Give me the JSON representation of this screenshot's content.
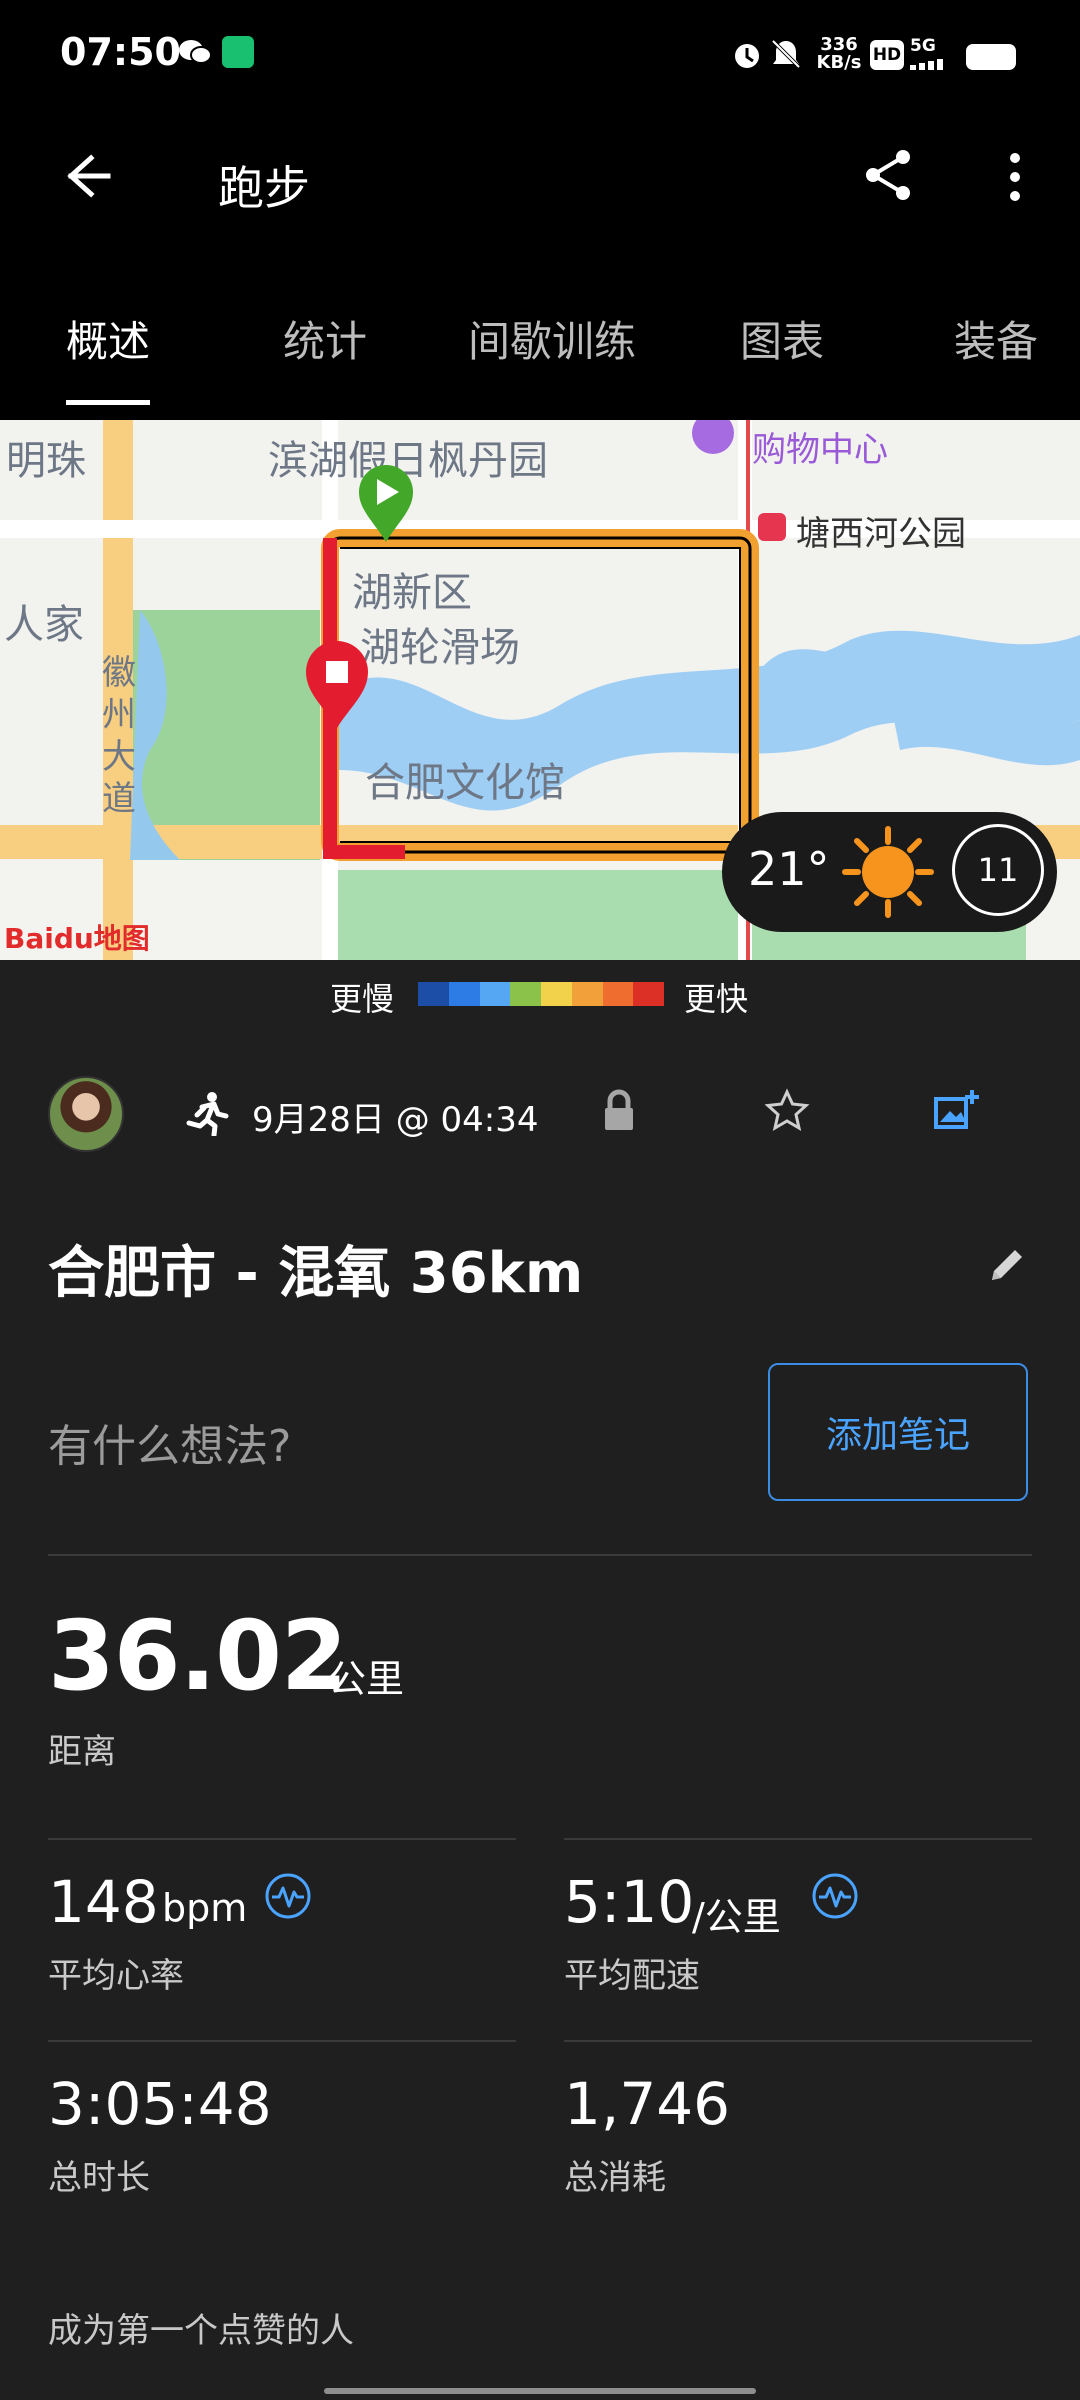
{
  "status_bar": {
    "time": "07:50",
    "network_speed_top": "336",
    "network_speed_bottom": "KB/s",
    "hd": "HD",
    "network_type": "5G"
  },
  "header": {
    "title": "跑步"
  },
  "tabs": [
    "概述",
    "统计",
    "间歇训练",
    "图表",
    "装备"
  ],
  "map": {
    "labels": {
      "mingzhu": "明珠",
      "binhu_garden": "滨湖假日枫丹园",
      "renjia": "人家",
      "binhu_xinqu": "湖新区",
      "skating": "湖轮滑场",
      "culture_center": "合肥文化馆",
      "huizhou_avenue": "徽州大道",
      "shopping_center": "购物中心",
      "tangxi_park": "塘西河公园",
      "baidu_logo": "Baidu地图"
    },
    "weather": {
      "temperature": "21°",
      "wind_speed": "11"
    }
  },
  "legend": {
    "slower": "更慢",
    "faster": "更快",
    "colors": [
      "#1d4ea7",
      "#2d7be4",
      "#56a7f3",
      "#8bc34a",
      "#f2d24b",
      "#f2a13a",
      "#ef6d2f",
      "#dc2f25"
    ]
  },
  "activity": {
    "date_time": "9月28日 @ 04:34",
    "title": "合肥市 - 混氧 36km",
    "thoughts_placeholder": "有什么想法?",
    "add_note_label": "添加笔记"
  },
  "stats": {
    "distance": {
      "value": "36.02",
      "unit": "公里",
      "label": "距离"
    },
    "heart_rate": {
      "value": "148",
      "unit": "bpm",
      "label": "平均心率"
    },
    "pace": {
      "value": "5:10",
      "unit": "/公里",
      "label": "平均配速"
    },
    "duration": {
      "value": "3:05:48",
      "label": "总时长"
    },
    "calories": {
      "value": "1,746",
      "label": "总消耗"
    }
  },
  "social": {
    "first_like": "成为第一个点赞的人"
  },
  "colors": {
    "background": "#1f1f1f",
    "accent_blue": "#3b8ce3",
    "route_red": "#e31d2f",
    "route_orange": "#f39c1f",
    "start_green": "#43a829"
  }
}
